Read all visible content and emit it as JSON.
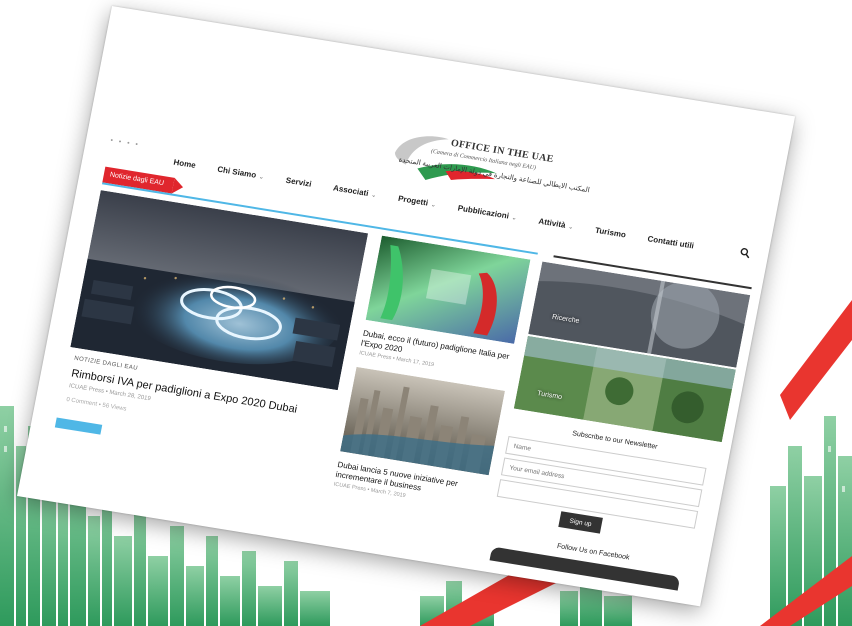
{
  "logo": {
    "title": "OFFICE IN THE UAE",
    "subtitle": "(Camera di Commercio Italiana negli EAU)",
    "arabic": "المكتب الايطالي للصناعة والتجارة في دولة الإمارات العربية المتحدة"
  },
  "nav": {
    "items": [
      {
        "label": "Home",
        "dropdown": false
      },
      {
        "label": "Chi Siamo",
        "dropdown": true
      },
      {
        "label": "Servizi",
        "dropdown": false
      },
      {
        "label": "Associati",
        "dropdown": true
      },
      {
        "label": "Progetti",
        "dropdown": true
      },
      {
        "label": "Pubblicazioni",
        "dropdown": true
      },
      {
        "label": "Attività",
        "dropdown": true
      },
      {
        "label": "Turismo",
        "dropdown": false
      },
      {
        "label": "Contatti utili",
        "dropdown": false
      }
    ],
    "dropdown_glyph": "⌄",
    "search_icon": "search-icon"
  },
  "section_tag": "Notizie dagli EAU",
  "feature": {
    "category": "NOTIZIE DAGLI EAU",
    "title": "Rimborsi IVA per padiglioni a Expo 2020 Dubai",
    "meta": "ICUAE Press  •  March 28, 2019",
    "stats": "0 Comment  •  56 Views"
  },
  "articles": [
    {
      "title": "Dubai, ecco il (futuro) padiglione Italia per l'Expo 2020",
      "meta": "ICUAE Press  •  March 17, 2019"
    },
    {
      "title": "Dubai lancia 5 nuove iniziative per incrementare il business",
      "meta": "ICUAE Press  •  March 7, 2019"
    }
  ],
  "tiles": {
    "ricerche": "Ricerche",
    "turismo": "Turismo"
  },
  "newsletter": {
    "title": "Subscribe to our Newsletter",
    "name_placeholder": "Name",
    "email_placeholder": "Your email address",
    "button": "Sign up"
  },
  "facebook": {
    "title": "Follow Us on Facebook"
  },
  "colors": {
    "accent_red": "#e0262d",
    "accent_blue": "#4fb7e6",
    "skyline_green": "#3aa86b"
  }
}
